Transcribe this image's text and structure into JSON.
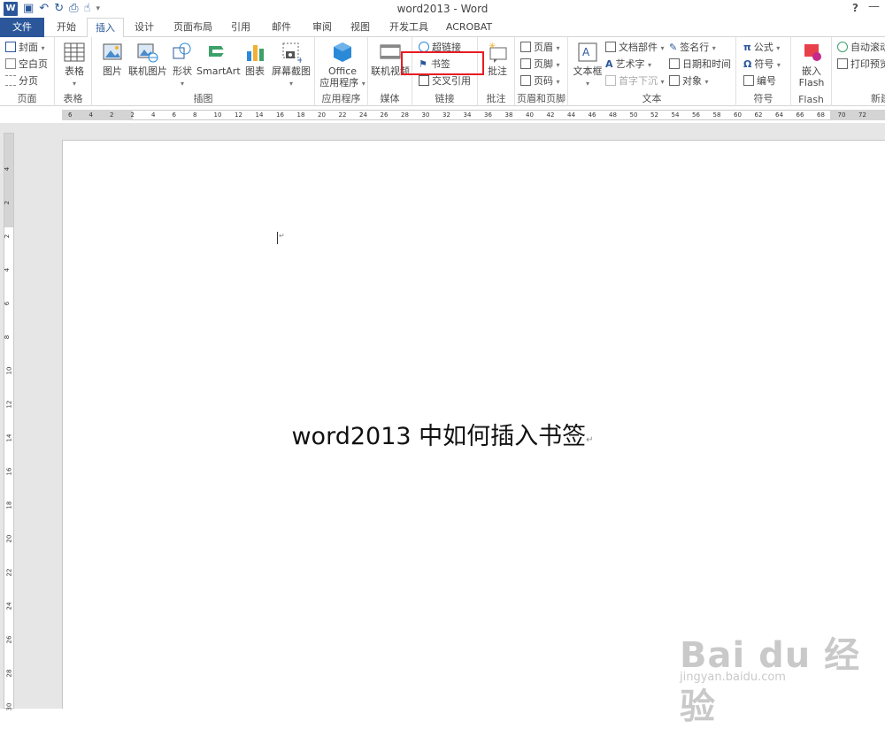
{
  "window": {
    "title": "word2013 - Word",
    "help": "?",
    "minimize": "—"
  },
  "tabs": [
    {
      "label": "文件"
    },
    {
      "label": "开始"
    },
    {
      "label": "插入"
    },
    {
      "label": "设计"
    },
    {
      "label": "页面布局"
    },
    {
      "label": "引用"
    },
    {
      "label": "邮件"
    },
    {
      "label": "审阅"
    },
    {
      "label": "视图"
    },
    {
      "label": "开发工具"
    },
    {
      "label": "ACROBAT"
    }
  ],
  "ribbon": {
    "pages": {
      "group": "页面",
      "cover": "封面",
      "blank": "空白页",
      "break": "分页"
    },
    "tables": {
      "group": "表格",
      "table": "表格"
    },
    "illustrations": {
      "group": "插图",
      "picture": "图片",
      "online_picture": "联机图片",
      "shapes": "形状",
      "smartart": "SmartArt",
      "chart": "图表",
      "screenshot": "屏幕截图"
    },
    "apps": {
      "group": "应用程序",
      "office_l1": "Office",
      "office_l2": "应用程序"
    },
    "media": {
      "group": "媒体",
      "online_video": "联机视频"
    },
    "links": {
      "group": "链接",
      "hyperlink": "超链接",
      "bookmark": "书签",
      "cross_ref": "交叉引用"
    },
    "comments": {
      "group": "批注",
      "comment": "批注"
    },
    "header_footer": {
      "group": "页眉和页脚",
      "header": "页眉",
      "footer": "页脚",
      "page_number": "页码"
    },
    "text": {
      "group": "文本",
      "textbox": "文本框",
      "quick_parts": "文档部件",
      "wordart": "艺术字",
      "dropcap": "首字下沉",
      "signature": "签名行",
      "datetime": "日期和时间",
      "object": "对象"
    },
    "symbols": {
      "group": "符号",
      "equation": "公式",
      "symbol": "符号",
      "number": "编号"
    },
    "flash": {
      "group": "Flash",
      "embed_l1": "嵌入",
      "embed_l2": "Flash"
    },
    "new": {
      "group": "新建",
      "auto_scroll": "自动滚动",
      "print_preview": "打印预览"
    }
  },
  "ruler_h": [
    "6",
    "4",
    "2",
    "2",
    "4",
    "6",
    "8",
    "10",
    "12",
    "14",
    "16",
    "18",
    "20",
    "22",
    "24",
    "26",
    "28",
    "30",
    "32",
    "34",
    "36",
    "38",
    "40",
    "42",
    "44",
    "46",
    "48",
    "50",
    "52",
    "54",
    "56",
    "58",
    "60",
    "62",
    "64",
    "66",
    "68",
    "70",
    "72"
  ],
  "ruler_v": [
    "4",
    "2",
    "2",
    "4",
    "6",
    "8",
    "10",
    "12",
    "14",
    "16",
    "18",
    "20",
    "22",
    "24",
    "26",
    "28",
    "30"
  ],
  "document": {
    "heading": "word2013 中如何插入书签",
    "para_mark": "↵"
  },
  "watermark": {
    "brand": "Bai du 经验",
    "url": "jingyan.baidu.com"
  },
  "accent_color": "#2b579a",
  "highlight_color": "#e81b23"
}
